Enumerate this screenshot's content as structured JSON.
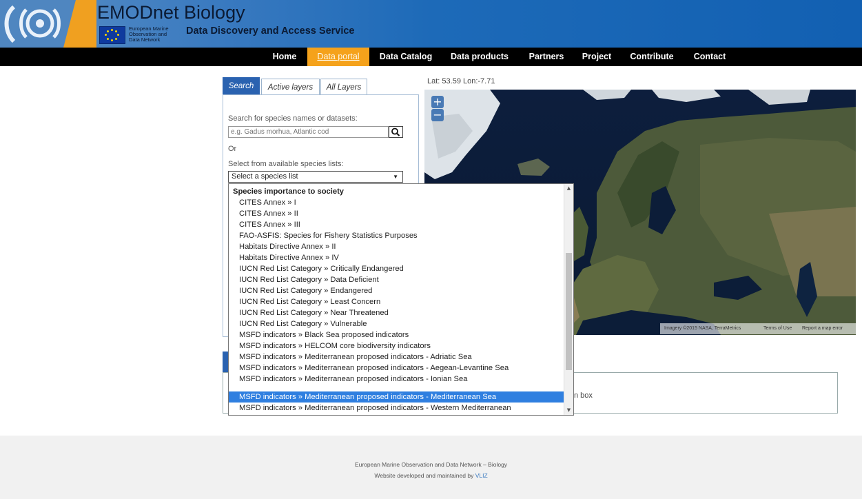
{
  "header": {
    "title": "EMODnet Biology",
    "eu_text": [
      "European Marine",
      "Observation and",
      "Data Network"
    ],
    "subtitle": "Data Discovery and Access Service"
  },
  "nav": {
    "items": [
      "Home",
      "Data portal",
      "Data Catalog",
      "Data products",
      "Partners",
      "Project",
      "Contribute",
      "Contact"
    ],
    "active": "Data portal",
    "active_color": "#f5a21b"
  },
  "tabs": {
    "search": "Search",
    "active_layers": "Active layers",
    "all_layers": "All Layers",
    "active_tab": "Search"
  },
  "search": {
    "label": "Search for species names or datasets:",
    "placeholder": "e.g. Gadus morhua, Atlantic cod",
    "icon": "search-icon",
    "or_text": "Or",
    "list_label": "Select from available species lists:",
    "select_value": "Select a species list"
  },
  "map": {
    "coords": "Lat: 53.59  Lon:-7.71",
    "zoom_in": "+",
    "zoom_out": "−",
    "attribution": {
      "imagery": "Imagery ©2015 NASA, TerraMetrics",
      "terms": "Terms of Use",
      "report": "Report a map error"
    }
  },
  "dropdown": {
    "group": "Species importance to society",
    "options": [
      "CITES Annex » I",
      "CITES Annex » II",
      "CITES Annex » III",
      "FAO-ASFIS: Species for Fishery Statistics Purposes",
      "Habitats Directive Annex » II",
      "Habitats Directive Annex » IV",
      "IUCN Red List Category » Critically Endangered",
      "IUCN Red List Category » Data Deficient",
      "IUCN Red List Category » Endangered",
      "IUCN Red List Category » Least Concern",
      "IUCN Red List Category » Near Threatened",
      "IUCN Red List Category » Vulnerable",
      "MSFD indicators » Black Sea proposed indicators",
      "MSFD indicators » HELCOM core biodiversity indicators",
      "MSFD indicators » Mediterranean proposed indicators - Adriatic Sea",
      "MSFD indicators » Mediterranean proposed indicators - Aegean-Levantine Sea",
      "MSFD indicators » Mediterranean proposed indicators - Ionian Sea",
      "MSFD indicators » Mediterranean proposed indicators - Mediterranean Sea",
      "MSFD indicators » Mediterranean proposed indicators - Western Mediterranean"
    ],
    "selected_index": 17,
    "selected_color": "#2f7fe0"
  },
  "results": {
    "partial_text": "n box"
  },
  "footer": {
    "line1": "European Marine Observation and Data Network – Biology",
    "line2_prefix": "Website developed and maintained by ",
    "line2_link": "VLIZ"
  }
}
